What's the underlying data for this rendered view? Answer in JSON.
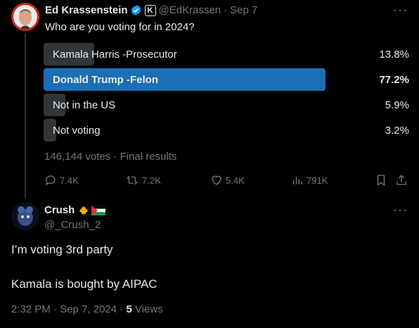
{
  "tweet": {
    "author_name": "Ed Krassenstein",
    "handle": "@EdKrassen",
    "separator": "·",
    "date": "Sep 7",
    "affiliate_badge": "K",
    "text": "Who are you voting for in 2024?",
    "poll": {
      "options": [
        {
          "label": "Kamala Harris -Prosecutor",
          "percent": "13.8%",
          "value": 13.8,
          "winner": false
        },
        {
          "label": "Donald Trump -Felon",
          "percent": "77.2%",
          "value": 77.2,
          "winner": true
        },
        {
          "label": "Not in the US",
          "percent": "5.9%",
          "value": 5.9,
          "winner": false
        },
        {
          "label": "Not voting",
          "percent": "3.2%",
          "value": 3.2,
          "winner": false
        }
      ],
      "summary": "146,144 votes · Final results"
    },
    "actions": {
      "replies": "7.4K",
      "reposts": "7.2K",
      "likes": "5.4K",
      "views": "791K"
    }
  },
  "reply": {
    "author_name": "Crush",
    "handle": "@_Crush_2",
    "emoji_flags": [
      "maple-leaf-icon",
      "palestine-flag-icon"
    ],
    "line1": "I’m voting 3rd party",
    "line2": "Kamala is bought by AIPAC",
    "timestamp": "2:32 PM · Sep 7, 2024 · ",
    "views_count": "5",
    "views_label": " Views"
  },
  "colors": {
    "background": "#000000",
    "text": "#e7e9ea",
    "muted": "#71767b",
    "poll_winner": "#1d6fb5",
    "poll_bar": "#333639",
    "verified": "#1d9bf0"
  }
}
